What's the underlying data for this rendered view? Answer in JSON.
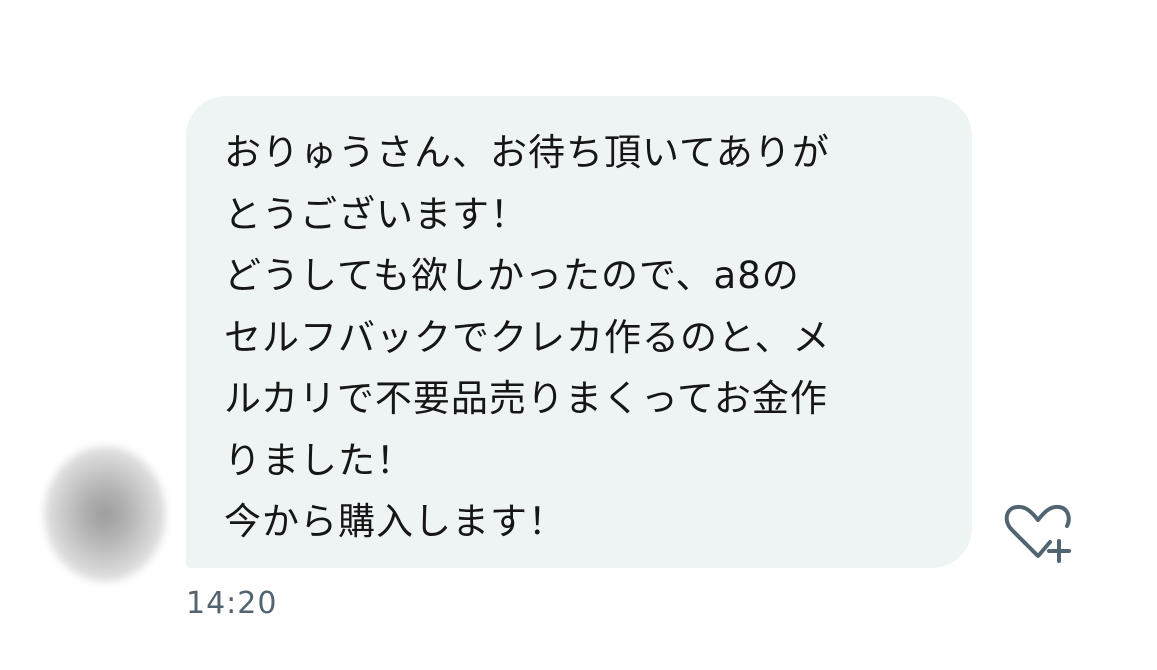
{
  "conversation": {
    "avatar": {
      "icon": "blurred-avatar"
    },
    "message": {
      "lines": [
        "おりゅうさん、お待ち頂いてありが",
        "とうございます！",
        "どうしても欲しかったので、a8の",
        "セルフバックでクレカ作るのと、メ",
        "ルカリで不要品売りまくってお金作",
        "りました！",
        "今から購入します！"
      ],
      "timestamp": "14:20"
    },
    "reaction": {
      "icon": "heart-plus-icon",
      "color": "#536471"
    },
    "colors": {
      "bubble_background": "#eef3f4",
      "text": "#161616",
      "timestamp": "#536471"
    }
  }
}
